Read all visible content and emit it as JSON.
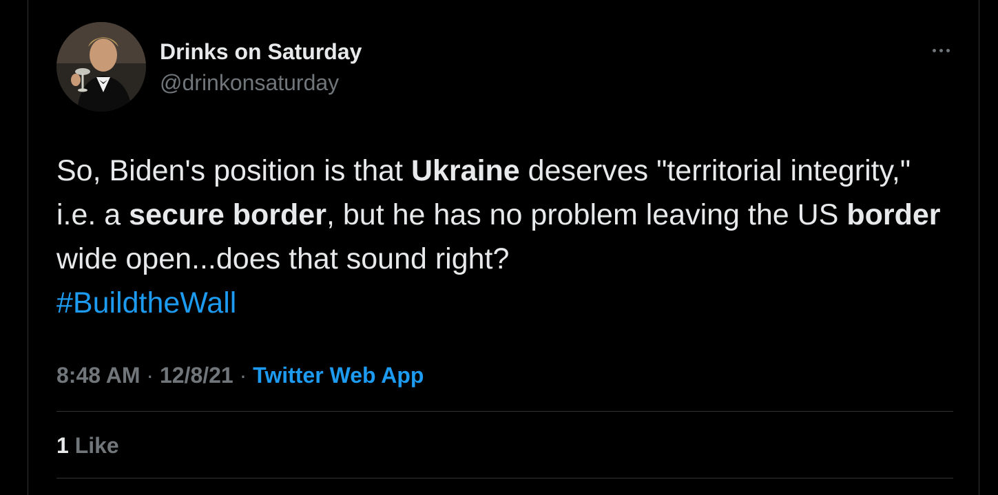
{
  "tweet": {
    "author": {
      "display_name": "Drinks on Saturday",
      "handle": "@drinkonsaturday"
    },
    "text_segments": [
      {
        "text": "So, Biden's position is that ",
        "style": "normal"
      },
      {
        "text": "Ukraine",
        "style": "bold"
      },
      {
        "text": " deserves \"territorial integrity,\" i.e. a ",
        "style": "normal"
      },
      {
        "text": "secure border",
        "style": "bold"
      },
      {
        "text": ", but he has no problem leaving the US ",
        "style": "normal"
      },
      {
        "text": "border",
        "style": "bold"
      },
      {
        "text": " wide open...does that sound right? ",
        "style": "normal"
      }
    ],
    "hashtag": "#BuildtheWall",
    "time": "8:48 AM",
    "separator": "·",
    "date": "12/8/21",
    "source": "Twitter Web App",
    "likes": {
      "count": "1",
      "label": "Like"
    }
  },
  "icons": {
    "more": "more-horizontal-icon",
    "avatar": "profile-avatar"
  },
  "colors": {
    "background": "#000000",
    "text_primary": "#e7e9ea",
    "text_secondary": "#71767b",
    "accent": "#1d9bf0",
    "divider": "#2f3336"
  }
}
